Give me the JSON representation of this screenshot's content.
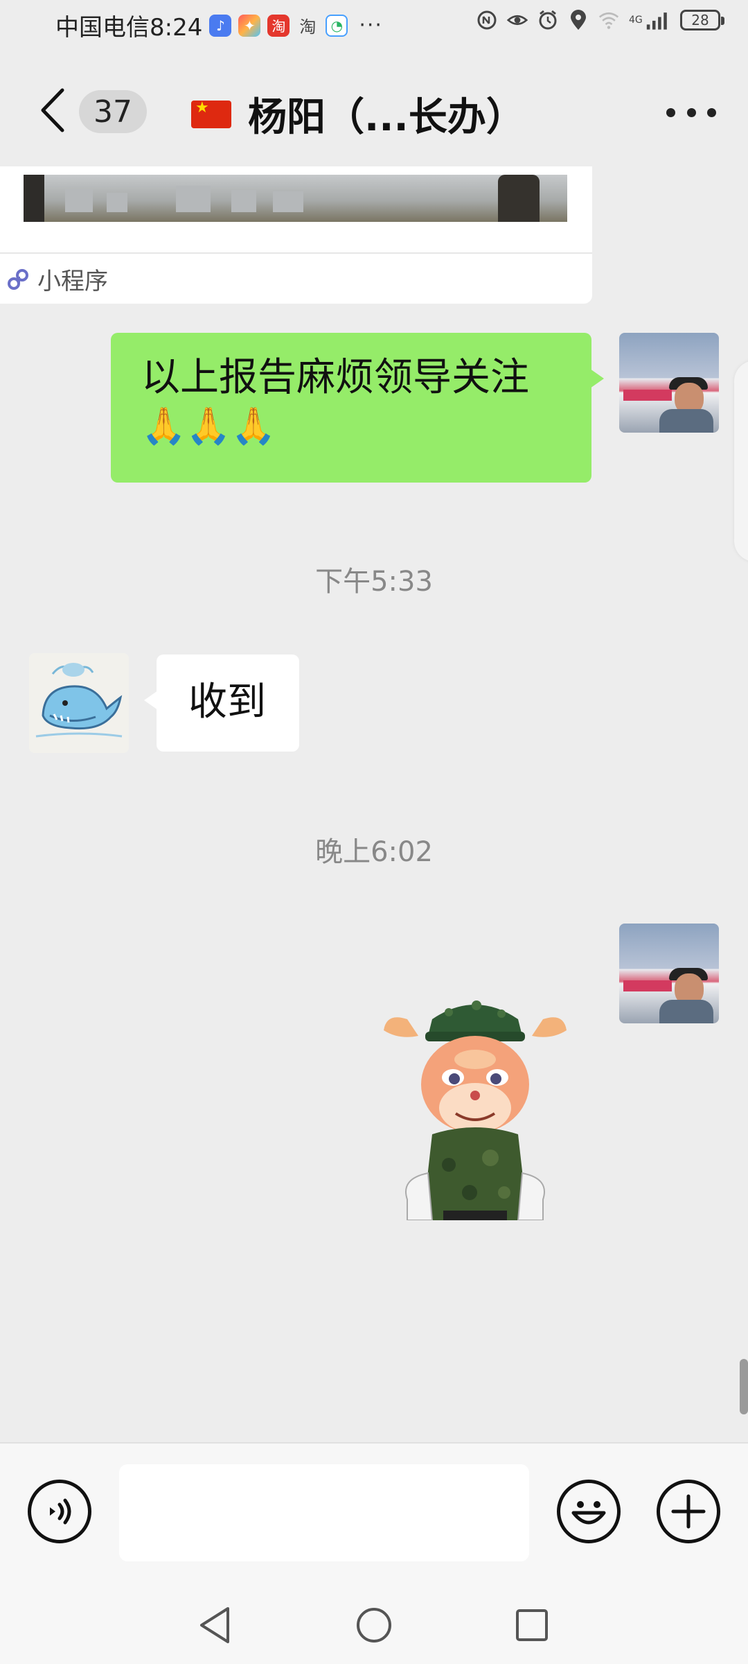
{
  "status_bar": {
    "carrier_time": "中国电信8:24",
    "apps": [
      "music-app-icon",
      "colorful-app-icon",
      "taobao-app-icon",
      "taobao-text-icon",
      "messages-app-icon"
    ],
    "taobao_label": "淘",
    "taobao_text": "淘",
    "more": "···",
    "battery": "28",
    "network": "4G"
  },
  "header": {
    "unread_count": "37",
    "title": "杨阳（...长办）",
    "flag": "china-flag-icon"
  },
  "chat": {
    "mini_program_label": "小程序",
    "messages": [
      {
        "side": "out",
        "text": "以上报告麻烦领导关注",
        "emoji": "🙏🙏🙏"
      },
      {
        "time": "下午5:33"
      },
      {
        "side": "in",
        "text": "收到"
      },
      {
        "time": "晚上6:02"
      },
      {
        "side": "out",
        "type": "sticker",
        "sticker": "deer-soldier-sticker"
      }
    ]
  },
  "input_bar": {
    "voice_icon": "voice-icon",
    "emoji_icon": "emoji-icon",
    "plus_icon": "plus-icon",
    "placeholder": ""
  },
  "colors": {
    "bubble_out": "#95ec69",
    "bubble_in": "#ffffff",
    "background": "#ededed"
  }
}
